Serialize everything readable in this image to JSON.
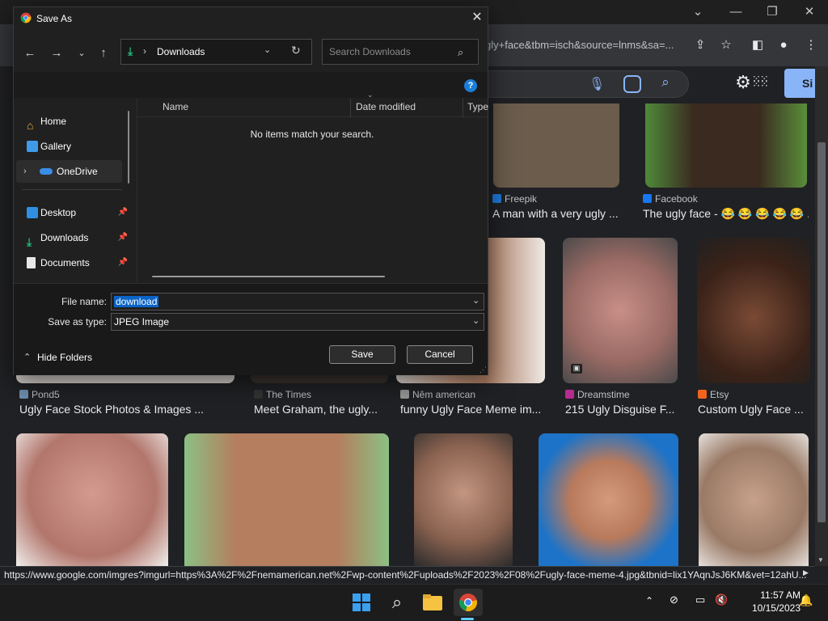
{
  "browser": {
    "url_fragment": "gly+face&tbm=isch&source=lnms&sa=...",
    "signin_label": "Si",
    "status_url": "https://www.google.com/imgres?imgurl=https%3A%2F%2Fnemamerican.net%2Fwp-content%2Fuploads%2F2023%2F08%2Fugly-face-meme-4.jpg&tbnid=lix1YAqnJsJ6KM&vet=12ahU..."
  },
  "results": {
    "row1": [
      {
        "source": "Freepik",
        "caption": "A man with a very ugly ...",
        "fav_color": "#1e7bd9"
      },
      {
        "source": "Facebook",
        "caption": "The ugly face - 😂 😂 😂 😂 😂 ...",
        "fav_color": "#1877f2"
      }
    ],
    "row2": [
      {
        "source": "Pond5",
        "caption": "Ugly Face Stock Photos & Images ...",
        "fav_color": "#6f8fb0"
      },
      {
        "source": "The Times",
        "caption": "Meet Graham, the ugly...",
        "fav_color": "#333333"
      },
      {
        "source": "Nêm american",
        "caption": "funny Ugly Face Meme im...",
        "fav_color": "#999999"
      },
      {
        "source": "Dreamstime",
        "caption": "215 Ugly Disguise F...",
        "fav_color": "#b52c8e"
      },
      {
        "source": "Etsy",
        "caption": "Custom Ugly Face ...",
        "fav_color": "#f1641e"
      }
    ]
  },
  "dialog": {
    "title": "Save As",
    "breadcrumb": "Downloads",
    "search_placeholder": "Search Downloads",
    "nav_items": [
      "Home",
      "Gallery",
      "OneDrive",
      "Desktop",
      "Downloads",
      "Documents"
    ],
    "columns": [
      "Name",
      "Date modified",
      "Type"
    ],
    "empty_message": "No items match your search.",
    "file_name_label": "File name:",
    "file_name_value": "download",
    "save_type_label": "Save as type:",
    "save_type_value": "JPEG Image",
    "hide_folders": "Hide Folders",
    "save": "Save",
    "cancel": "Cancel"
  },
  "taskbar": {
    "time": "11:57 AM",
    "date": "10/15/2023"
  }
}
